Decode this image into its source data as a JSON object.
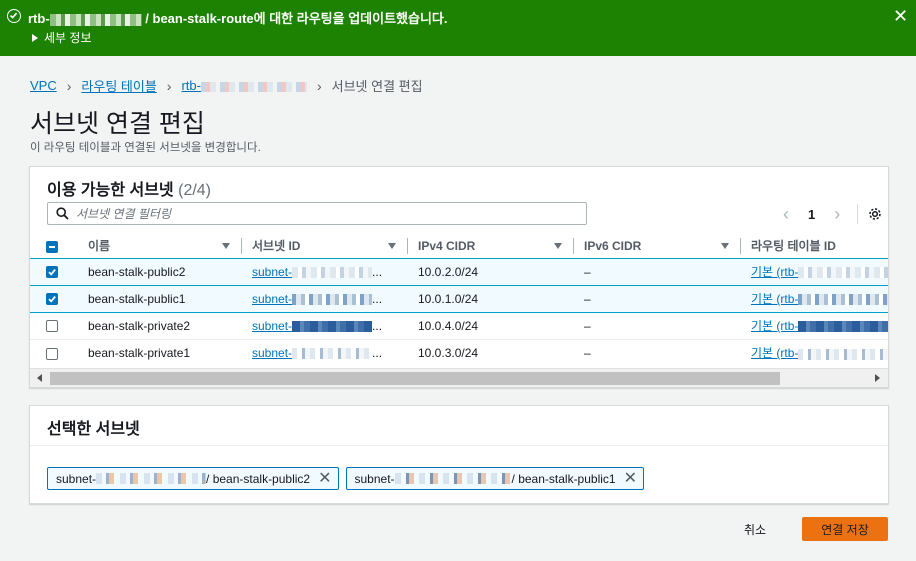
{
  "flash": {
    "prefix": "rtb-",
    "suffix": " / bean-stalk-route에 대한 라우팅을 업데이트했습니다.",
    "details_label": "세부 정보",
    "color": "#1d8102"
  },
  "breadcrumb": {
    "items": [
      "VPC",
      "라우팅 테이블",
      "rtb-"
    ],
    "current": "서브넷 연결 편집"
  },
  "page": {
    "title": "서브넷 연결 편집",
    "description": "이 라우팅 테이블과 연결된 서브넷을 변경합니다."
  },
  "available": {
    "title": "이용 가능한 서브넷",
    "count": "(2/4)",
    "search_placeholder": "서브넷 연결 필터링",
    "page_number": "1",
    "columns": [
      "이름",
      "서브넷 ID",
      "IPv4 CIDR",
      "IPv6 CIDR",
      "라우팅 테이블 ID"
    ],
    "rows": [
      {
        "selected": true,
        "name": "bean-stalk-public2",
        "subnet": "subnet-",
        "ipv4": "10.0.2.0/24",
        "ipv6": "–",
        "route": "기본 (rtb-"
      },
      {
        "selected": true,
        "name": "bean-stalk-public1",
        "subnet": "subnet-",
        "ipv4": "10.0.1.0/24",
        "ipv6": "–",
        "route": "기본 (rtb-"
      },
      {
        "selected": false,
        "name": "bean-stalk-private2",
        "subnet": "subnet-",
        "ipv4": "10.0.4.0/24",
        "ipv6": "–",
        "route": "기본 (rtb-"
      },
      {
        "selected": false,
        "name": "bean-stalk-private1",
        "subnet": "subnet-",
        "ipv4": "10.0.3.0/24",
        "ipv6": "–",
        "route": "기본 (rtb-"
      }
    ],
    "ellipsis": "..."
  },
  "selected": {
    "title": "선택한 서브넷",
    "tokens": [
      {
        "prefix": "subnet-",
        "name": "/ bean-stalk-public2"
      },
      {
        "prefix": "subnet-",
        "name": "/ bean-stalk-public1"
      }
    ]
  },
  "actions": {
    "cancel_label": "취소",
    "save_label": "연결 저장",
    "save_color": "#ec7211"
  },
  "icons": {
    "success": "check-circle-icon",
    "close": "close-icon",
    "search": "search-icon",
    "settings": "gear-icon",
    "token_remove": "close-icon"
  }
}
